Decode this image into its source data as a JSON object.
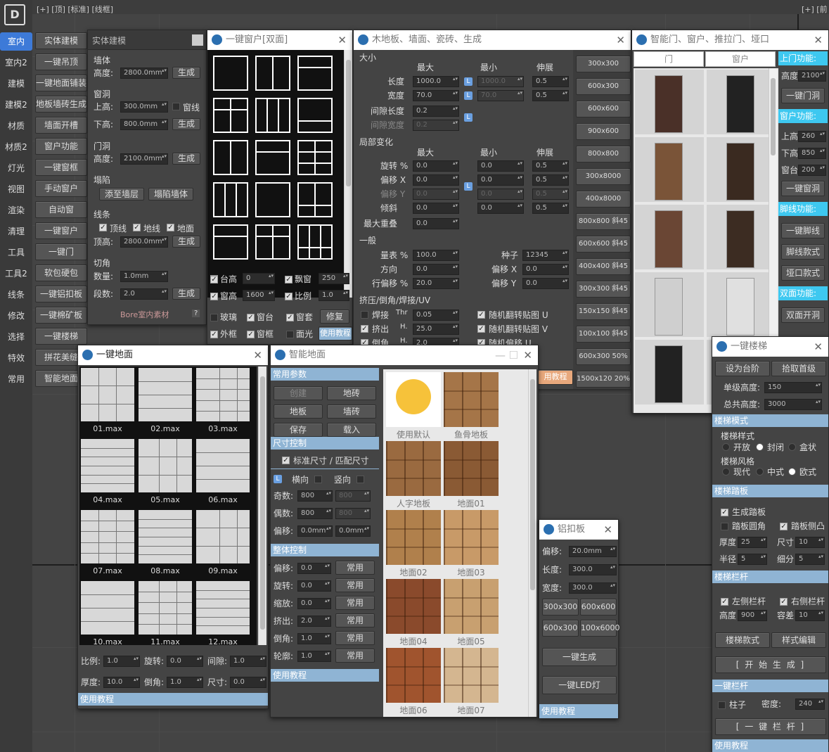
{
  "topbar": {
    "left": "[+] [顶] [标准] [线框]",
    "right": "[+] [前"
  },
  "left_tabs": [
    "室内",
    "室内2",
    "建模",
    "建模2",
    "材质",
    "材质2",
    "灯光",
    "视图",
    "渲染",
    "清理",
    "工具",
    "工具2",
    "线条",
    "修改",
    "选择",
    "特效",
    "常用"
  ],
  "col2_buttons": [
    "实体建模",
    "一键吊顶",
    "一键地面铺装",
    "地板墙砖生成",
    "墙面开槽",
    "窗户功能",
    "一键窗框",
    "手动窗户",
    "自动窗",
    "一键窗户",
    "一键门",
    "软包硬包",
    "一键铝扣板",
    "一键棉矿板",
    "一键楼梯",
    "拼花美缝",
    "智能地面"
  ],
  "solid": {
    "title": "实体建模",
    "wall": "墙体",
    "height_lbl": "高度:",
    "height": "2800.0mm",
    "gen": "生成",
    "hole": "窗洞",
    "top_lbl": "上高:",
    "top": "300.0mm",
    "sill": "窗线",
    "bottom_lbl": "下高:",
    "bottom": "800.0mm",
    "door": "门洞",
    "door_h_lbl": "高度:",
    "door_h": "2100.0mm",
    "collapse": "塌陷",
    "add_floor": "添至墙层",
    "collapse_wall": "塌陷墙体",
    "lines": "线条",
    "top_line": "顶线",
    "floor_line": "地线",
    "ground": "地面",
    "top_h_lbl": "顶高:",
    "top_h": "2800.0mm",
    "cut": "切角",
    "count_lbl": "数量:",
    "count": "1.0mm",
    "seg_lbl": "段数:",
    "seg": "2.0",
    "brand": "Bore室内素材",
    "q": "?"
  },
  "windows": {
    "title": "一键窗户[双面]",
    "sill_h": "台高",
    "sill_v": "0",
    "bay": "飘窗",
    "bay_v": "250",
    "win_h": "窗高",
    "win_h_v": "1600",
    "ratio": "比例",
    "ratio_v": "1.0",
    "glass": "玻璃",
    "sill2": "窗台",
    "case": "窗套",
    "repair": "修复",
    "outer": "外框",
    "frame": "窗框",
    "light": "面光",
    "tutorial": "使用教程"
  },
  "wood": {
    "title": "木地板、墙面、瓷砖、生成",
    "size": "大小",
    "max": "最大",
    "min": "最小",
    "stretch": "伸展",
    "len": "长度",
    "len_max": "1000.0",
    "len_min": "1000.0",
    "len_s": "0.5",
    "wid": "宽度",
    "wid_max": "70.0",
    "wid_min": "70.0",
    "wid_s": "0.5",
    "gap_len": "间隙长度",
    "gap_len_v": "0.2",
    "gap_wid": "间隙宽度",
    "gap_wid_v": "0.2",
    "local": "局部变化",
    "rot": "旋转 %",
    "offx": "偏移 X",
    "offy": "偏移 Y",
    "tilt": "倾斜",
    "overlap": "最大重叠",
    "zero": "0.0",
    "half": "0.5",
    "general": "一般",
    "scale": "量表 %",
    "scale_v": "100.0",
    "seed": "种子",
    "seed_v": "12345",
    "dir": "方向",
    "rowoff": "行偏移 %",
    "rowoff_v": "20.0",
    "offx2": "偏移 X",
    "offy2": "偏移 Y",
    "extrude": "挤压/倒角/焊接/UV",
    "weld": "焊接",
    "thr": "Thr",
    "thr_v": "0.05",
    "ext": "挤出",
    "h": "H.",
    "ext_v": "25.0",
    "bev": "倒角",
    "bev_v": "2.0",
    "rand_u": "随机翻转贴图 U",
    "rand_v": "随机翻转贴图 V",
    "rand_off": "随机偏移 U",
    "tutorial": "用教程",
    "presets": [
      "300x300",
      "600x300",
      "600x600",
      "900x600",
      "800x800",
      "300x8000",
      "400x8000",
      "800x800 斜45",
      "600x600 斜45",
      "400x400 斜45",
      "300x300 斜45",
      "150x150 斜45",
      "100x100 斜45",
      "600x300  50%",
      "1500x120  20%"
    ]
  },
  "doors": {
    "title": "智能门、窗户、推拉门、垭口",
    "tab_door": "门",
    "tab_win": "窗户",
    "up_func": "上门功能:",
    "door_h_lbl": "高度",
    "door_h": "2100",
    "btn_door": "一键门洞",
    "win_func": "窗户功能:",
    "up_lbl": "上高",
    "up": "260",
    "down_lbl": "下高",
    "down": "850",
    "sill_lbl": "窗台",
    "sill": "200",
    "btn_win": "一键窗洞",
    "foot_func": "脚线功能:",
    "btn_foot": "一键脚线",
    "foot_style": "脚线款式",
    "arch_style": "垭口款式",
    "double_func": "双面功能:",
    "double_btn": "双面开洞"
  },
  "floor": {
    "title": "一键地面",
    "tiles": [
      "01.max",
      "02.max",
      "03.max",
      "04.max",
      "05.max",
      "06.max",
      "07.max",
      "08.max",
      "09.max",
      "10.max",
      "11.max",
      "12.max"
    ],
    "ratio": "比例:",
    "ratio_v": "1.0",
    "rot": "旋转:",
    "rot_v": "0.0",
    "gap": "间隙:",
    "gap_v": "1.0",
    "thick": "厚度:",
    "thick_v": "10.0",
    "bev": "倒角:",
    "bev_v": "1.0",
    "size": "尺寸:",
    "size_v": "0.0",
    "tutorial": "使用教程"
  },
  "smart": {
    "title": "智能地面",
    "common": "常用参数",
    "create": "创建",
    "floor_tile": "地砖",
    "floorb": "地板",
    "wall_tile": "墙砖",
    "save": "保存",
    "load": "载入",
    "size_ctrl": "尺寸控制",
    "std": "标准尺寸 / 匹配尺寸",
    "horiz": "横向",
    "vert": "竖向",
    "odd": "奇数:",
    "even": "偶数:",
    "offset": "偏移:",
    "v800": "800",
    "offv": "0.0mm",
    "overall": "整体控制",
    "o_off": "偏移:",
    "o_rot": "旋转:",
    "o_scale": "缩放:",
    "o_ext": "挤出:",
    "o_bev": "倒角:",
    "o_out": "轮廓:",
    "zero": "0.0",
    "two": "2.0",
    "one": "1.0",
    "common_btn": "常用",
    "tutorial": "使用教程",
    "thumbs": [
      "使用默认",
      "鱼骨地板",
      "人字地板",
      "地面01",
      "地面02",
      "地面03",
      "地面04",
      "地面05",
      "地面06",
      "地面07"
    ]
  },
  "alu": {
    "title": "铝扣板",
    "off": "偏移:",
    "off_v": "20.0mm",
    "len": "长度:",
    "len_v": "300.0",
    "wid": "宽度:",
    "wid_v": "300.0",
    "p1": "300x300",
    "p2": "600x600",
    "p3": "600x300",
    "p4": "100x6000",
    "gen": "一键生成",
    "led": "一键LED灯",
    "tutorial": "使用教程"
  },
  "stairs": {
    "title": "一键楼梯",
    "set_step": "设为台阶",
    "pick_first": "拾取首级",
    "step_h": "单级高度:",
    "step_h_v": "150",
    "total_h": "总共高度:",
    "total_h_v": "3000",
    "mode": "楼梯模式",
    "style": "楼梯样式",
    "open": "开放",
    "closed": "封闭",
    "box": "盒状",
    "fstyle": "楼梯风格",
    "modern": "现代",
    "chinese": "中式",
    "euro": "欧式",
    "tread": "楼梯踏板",
    "gen_tread": "生成踏板",
    "round": "踏板圆角",
    "side": "踏板侧凸",
    "thick": "厚度",
    "thick_v": "25",
    "size": "尺寸",
    "size_v": "10",
    "radius": "半径",
    "radius_v": "5",
    "sub": "细分",
    "sub_v": "5",
    "rail": "楼梯栏杆",
    "left": "左侧栏杆",
    "right": "右侧栏杆",
    "h": "高度",
    "h_v": "900",
    "tol": "容差",
    "tol_v": "10",
    "rail_style": "楼梯款式",
    "style_edit": "样式编辑",
    "start": "[ 开 始 生 成 ]",
    "one_rail": "一键栏杆",
    "post": "柱子",
    "density": "密度:",
    "density_v": "240",
    "one_rail_btn": "[ 一 键 栏 杆 ]",
    "tutorial": "使用教程"
  }
}
